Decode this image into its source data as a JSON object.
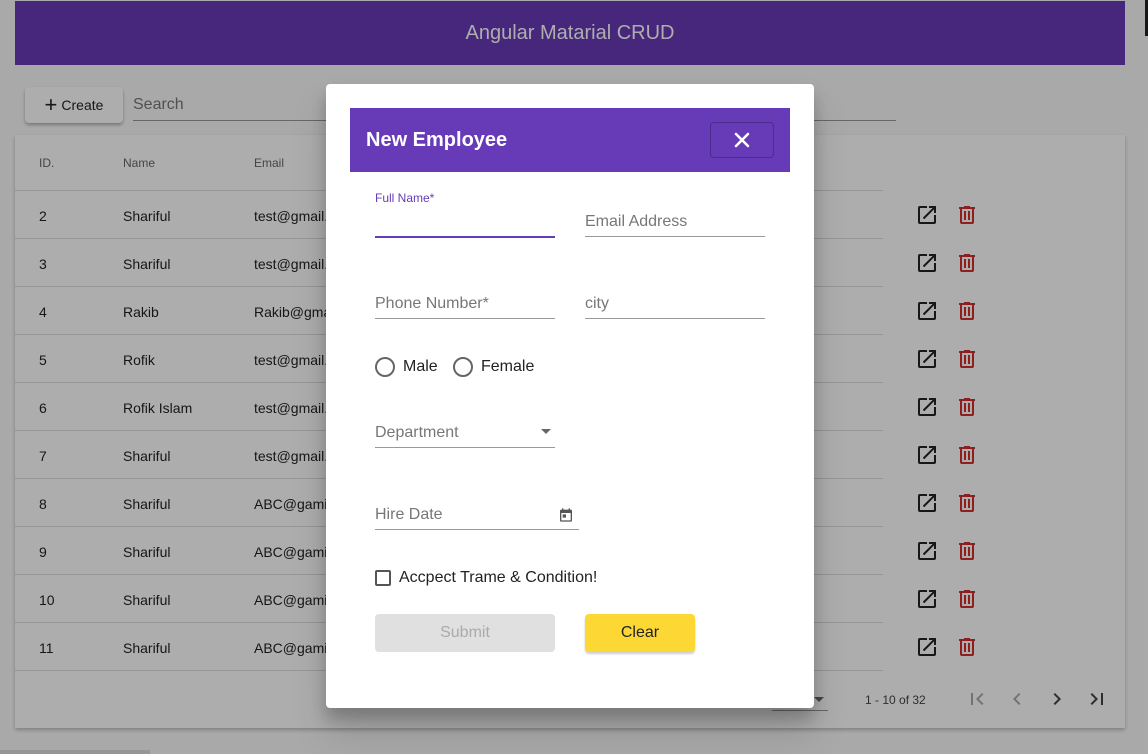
{
  "app": {
    "title": "Angular Matarial CRUD"
  },
  "actions": {
    "create_label": "Create",
    "search_placeholder": "Search"
  },
  "table": {
    "headers": {
      "id": "ID.",
      "name": "Name",
      "email": "Email"
    },
    "rows": [
      {
        "id": "2",
        "name": "Shariful",
        "email": "test@gmail."
      },
      {
        "id": "3",
        "name": "Shariful",
        "email": "test@gmail."
      },
      {
        "id": "4",
        "name": "Rakib",
        "email": "Rakib@gma"
      },
      {
        "id": "5",
        "name": "Rofik",
        "email": "test@gmail."
      },
      {
        "id": "6",
        "name": "Rofik Islam",
        "email": "test@gmail."
      },
      {
        "id": "7",
        "name": "Shariful",
        "email": "test@gmail."
      },
      {
        "id": "8",
        "name": "Shariful",
        "email": "ABC@gami"
      },
      {
        "id": "9",
        "name": "Shariful",
        "email": "ABC@gami"
      },
      {
        "id": "10",
        "name": "Shariful",
        "email": "ABC@gami"
      },
      {
        "id": "11",
        "name": "Shariful",
        "email": "ABC@gami"
      }
    ],
    "edit_icon": "open-in-new-icon",
    "delete_icon": "trash-icon",
    "delete_color": "#d32f2f"
  },
  "paginator": {
    "range_label": "1 - 10 of 32"
  },
  "dialog": {
    "title": "New Employee",
    "full_name_label": "Full Name*",
    "email_placeholder": "Email Address",
    "phone_placeholder": "Phone Number*",
    "city_placeholder": "city",
    "gender_options": [
      "Male",
      "Female"
    ],
    "department_placeholder": "Department",
    "hire_date_placeholder": "Hire Date",
    "terms_label": "Accpect Trame & Condition!",
    "submit_label": "Submit",
    "clear_label": "Clear"
  },
  "colors": {
    "primary": "#673ab7",
    "accent": "#fdd835",
    "warn": "#d32f2f"
  }
}
